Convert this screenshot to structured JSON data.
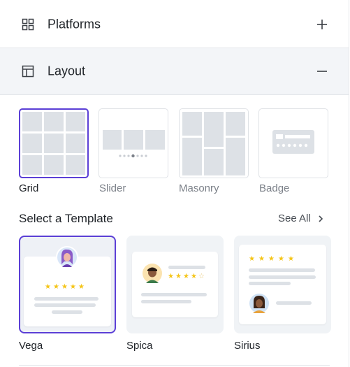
{
  "accordion": {
    "platforms": {
      "title": "Platforms",
      "icon": "grid-icon",
      "toggle": "plus-icon"
    },
    "layout": {
      "title": "Layout",
      "icon": "layout-icon",
      "toggle": "minus-icon"
    }
  },
  "layouts": [
    {
      "label": "Grid",
      "selected": true
    },
    {
      "label": "Slider",
      "selected": false
    },
    {
      "label": "Masonry",
      "selected": false
    },
    {
      "label": "Badge",
      "selected": false
    }
  ],
  "templates_section": {
    "title": "Select a Template",
    "see_all": "See All",
    "items": [
      {
        "label": "Vega",
        "selected": true
      },
      {
        "label": "Spica",
        "selected": false
      },
      {
        "label": "Sirius",
        "selected": false
      }
    ]
  },
  "colors": {
    "accent": "#5b3fd6",
    "star": "#f5c518",
    "placeholder": "#dde1e6"
  }
}
